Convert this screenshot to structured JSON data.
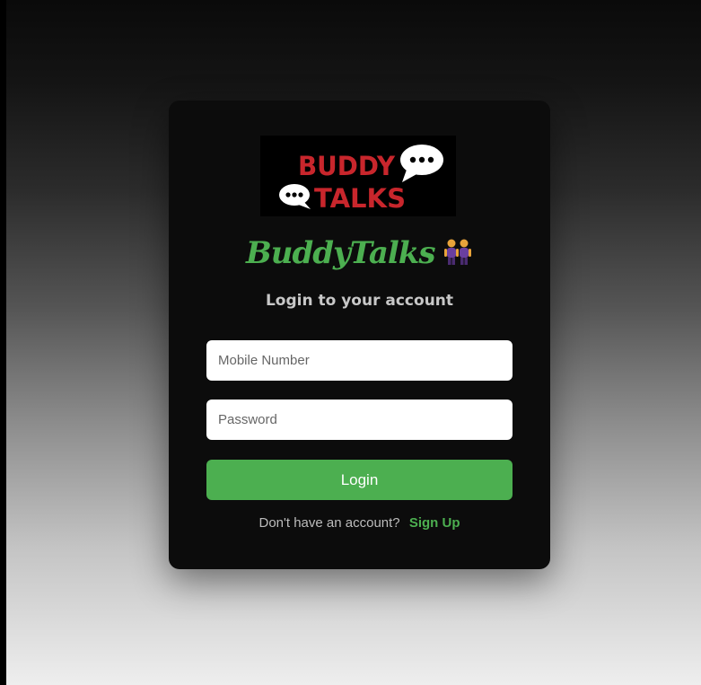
{
  "logo": {
    "line1": "BUDDY",
    "line2": "TALKS",
    "text_color": "#c8262c",
    "bubble_color": "#ffffff"
  },
  "brand": {
    "name": "BuddyTalks",
    "icon": "two-people-icon",
    "color": "#4caf50"
  },
  "subtitle": "Login to your account",
  "form": {
    "mobile_placeholder": "Mobile Number",
    "mobile_value": "",
    "password_placeholder": "Password",
    "password_value": "",
    "login_label": "Login"
  },
  "signup": {
    "prompt": "Don't have an account?",
    "link_label": "Sign Up"
  },
  "colors": {
    "accent": "#4caf50",
    "card_bg": "#0c0c0c"
  }
}
